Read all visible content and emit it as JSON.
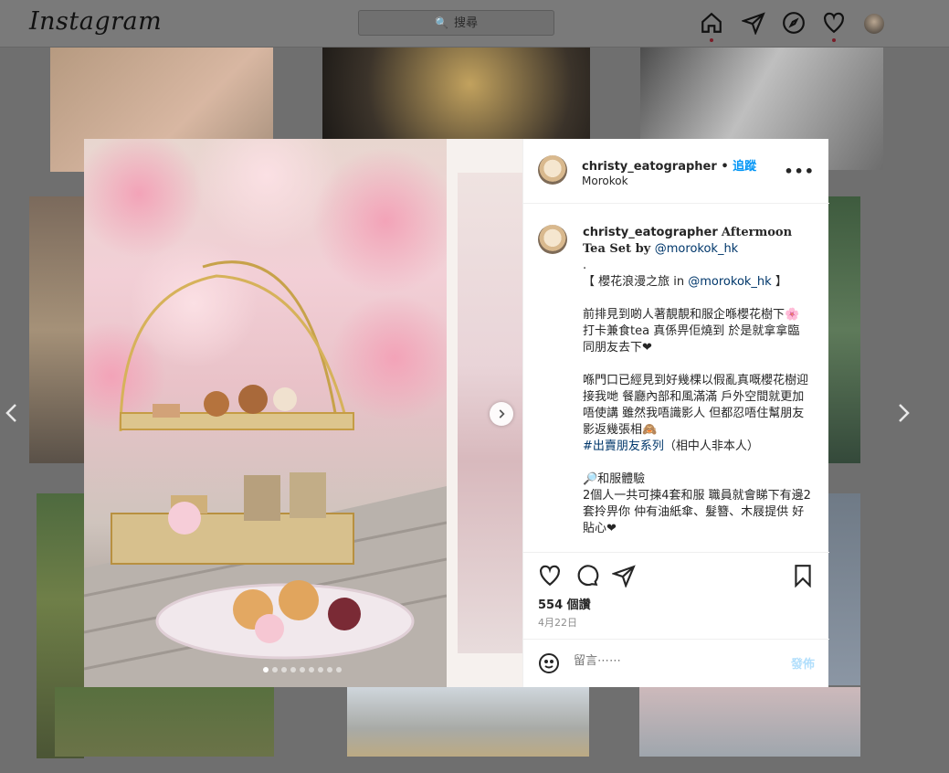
{
  "nav": {
    "logo": "Instagram",
    "search_placeholder": "搜尋"
  },
  "post": {
    "username": "christy_eatographer",
    "follow_label": "追蹤",
    "separator": "•",
    "location": "Morokok",
    "more_label": "•••",
    "caption": {
      "username": "christy_eatographer",
      "title": "Aftermoon Tea Set by ",
      "mention": "@morokok_hk",
      "line_dot": ".",
      "line_theme_prefix": "【 櫻花浪漫之旅 in ",
      "line_theme_mention": "@morokok_hk",
      "line_theme_suffix": " 】",
      "para1": "前排見到啲人著靚靚和服企喺櫻花樹下🌸打卡兼食tea 真係畀佢燒到 於是就拿拿臨同朋友去下❤",
      "para2": "喺門口已經見到好幾棵以假亂真嘅櫻花樹迎接我哋 餐廳內部和風滿滿 戶外空間就更加唔使講 雖然我唔識影人 但都忍唔住幫朋友影返幾張相🙈",
      "hashtag": "#出賣朋友系列",
      "hashtag_suffix": "（相中人非本人）",
      "para3_title": "🔎和服體驗",
      "para3": "2個人一共可揀4套和服 職員就會睇下有邊2套拎畀你 仲有油紙傘、髮簪、木屐提供 好貼心❤"
    },
    "likes": "554 個讚",
    "date": "4月22日",
    "comment_placeholder": "留言⋯⋯",
    "post_label": "發佈",
    "carousel_count": 9,
    "carousel_active": 0
  },
  "colors": {
    "accent": "#0095f6",
    "link": "#00376b",
    "muted": "#8e8e8e"
  },
  "icons": [
    "home-icon",
    "direct-icon",
    "explore-icon",
    "activity-heart-icon",
    "heart-icon",
    "comment-icon",
    "share-icon",
    "bookmark-icon",
    "emoji-icon",
    "chevron-right-icon",
    "chevron-left-icon",
    "search-icon",
    "more-icon"
  ]
}
